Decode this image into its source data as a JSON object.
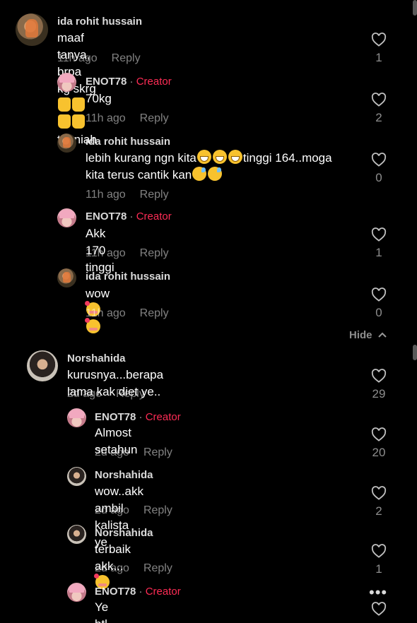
{
  "comments": [
    {
      "name": "ida rohit hussain",
      "creator": false,
      "text": "maaf tanya, brpa kg skrg",
      "text_suffix": "tahniah",
      "time": "11h ago",
      "reply": "Reply",
      "likes": "1"
    },
    {
      "name": "ENOT78",
      "creator": true,
      "creator_label": "Creator",
      "text": "70kg",
      "time": "11h ago",
      "reply": "Reply",
      "likes": "2"
    },
    {
      "name": "ida rohit hussain",
      "creator": false,
      "text": "lebih kurang ngn kita",
      "text_mid": "tinggi 164..moga",
      "text_line2": "kita terus cantik kan",
      "time": "11h ago",
      "reply": "Reply",
      "likes": "0"
    },
    {
      "name": "ENOT78",
      "creator": true,
      "creator_label": "Creator",
      "text": "Akk 170 tinggi",
      "time": "11h ago",
      "reply": "Reply",
      "likes": "1"
    },
    {
      "name": "ida rohit hussain",
      "creator": false,
      "text": "wow",
      "time": "11h ago",
      "reply": "Reply",
      "likes": "0"
    },
    {
      "name": "Norshahida",
      "creator": false,
      "text": "kurusnya...berapa lama kak diet ye..",
      "time": "2d ago",
      "reply": "Reply",
      "likes": "29"
    },
    {
      "name": "ENOT78",
      "creator": true,
      "creator_label": "Creator",
      "text": "Almost setahun",
      "time": "2d ago",
      "reply": "Reply",
      "likes": "20"
    },
    {
      "name": "Norshahida",
      "creator": false,
      "text": "wow..akk ambil kalista ye",
      "time": "2d ago",
      "reply": "Reply",
      "likes": "2"
    },
    {
      "name": "Norshahida",
      "creator": false,
      "text": "terbaik akk...",
      "time": "2d ago",
      "reply": "Reply",
      "likes": "1"
    },
    {
      "name": "ENOT78",
      "creator": true,
      "creator_label": "Creator",
      "text": "Ye btl"
    }
  ],
  "hide_toggle": "Hide",
  "separator": "·",
  "icons": {
    "like": "heart-outline-icon",
    "more": "more-dots-icon",
    "hide": "chevron-up-icon"
  },
  "colors": {
    "background": "#000000",
    "creator": "#fe2c55",
    "text": "#ffffff"
  }
}
